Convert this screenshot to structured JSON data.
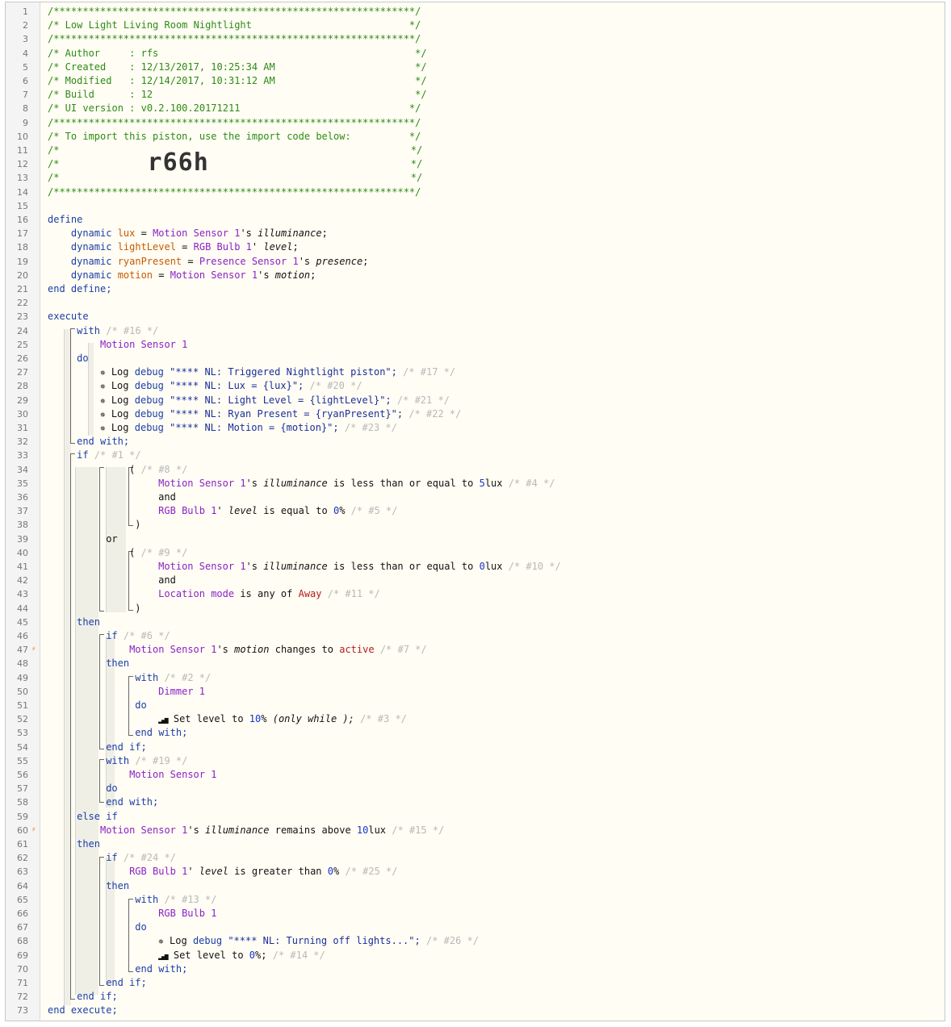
{
  "header": {
    "border": "/**************************************************************/",
    "title": "/* Low Light Living Room Nightlight                           */",
    "author": "/* Author     : rfs                                            */",
    "created": "/* Created    : 12/13/2017, 10:25:34 AM                        */",
    "modified": "/* Modified   : 12/14/2017, 10:31:12 AM                        */",
    "build": "/* Build      : 12                                             */",
    "ui_version": "/* UI version : v0.2.100.20171211                             */",
    "import_hint": "/* To import this piston, use the import code below:          */",
    "blank_open": "/*",
    "blank_close": "*/",
    "import_code": "r66h"
  },
  "define": {
    "kw_define": "define",
    "kw_end": "end define;",
    "kw_dynamic": "dynamic",
    "vars": [
      {
        "name": "lux",
        "device": "Motion Sensor 1",
        "poss": "'s",
        "attr": "illuminance"
      },
      {
        "name": "lightLevel",
        "device": "RGB Bulb 1",
        "poss": "'",
        "attr": "level"
      },
      {
        "name": "ryanPresent",
        "device": "Presence Sensor 1",
        "poss": "'s",
        "attr": "presence"
      },
      {
        "name": "motion",
        "device": "Motion Sensor 1",
        "poss": "'s",
        "attr": "motion"
      }
    ]
  },
  "execute": {
    "kw_execute": "execute",
    "kw_end_execute": "end execute;",
    "kw_with": "with",
    "kw_do": "do",
    "kw_end_with": "end with;",
    "kw_if": "if",
    "kw_then": "then",
    "kw_or": "or",
    "kw_and": "and",
    "kw_else_if": "else if",
    "kw_end_if": "end if;",
    "with16": {
      "comment": "/* #16 */",
      "device": "Motion Sensor 1"
    },
    "logs": [
      {
        "text": "\"**** NL: Triggered Nightlight piston\";",
        "comment": "/* #17 */"
      },
      {
        "text": "\"**** NL: Lux = {lux}\";",
        "comment": "/* #20 */"
      },
      {
        "text": "\"**** NL: Light Level = {lightLevel}\";",
        "comment": "/* #21 */"
      },
      {
        "text": "\"**** NL: Ryan Present = {ryanPresent}\";",
        "comment": "/* #22 */"
      },
      {
        "text": "\"**** NL: Motion = {motion}\";",
        "comment": "/* #23 */"
      }
    ],
    "log_label": "Log",
    "log_level": "debug",
    "if1": "/* #1 */",
    "grp8": "/* #8 */",
    "grp9": "/* #9 */",
    "cond4": {
      "device": "Motion Sensor 1",
      "poss": "'s",
      "attr": "illuminance",
      "op": "is less than or equal to",
      "num": "5",
      "unit": "lux",
      "comment": "/* #4 */"
    },
    "cond5": {
      "device": "RGB Bulb 1",
      "poss": "'",
      "attr": "level",
      "op": "is equal to",
      "num": "0",
      "unit": "%",
      "comment": "/* #5 */"
    },
    "cond10": {
      "device": "Motion Sensor 1",
      "poss": "'s",
      "attr": "illuminance",
      "op": "is less than or equal to",
      "num": "0",
      "unit": "lux",
      "comment": "/* #10 */"
    },
    "cond11": {
      "device": "Location mode",
      "op": "is any of",
      "val": "Away",
      "comment": "/* #11 */"
    },
    "if6": "/* #6 */",
    "cond7": {
      "device": "Motion Sensor 1",
      "poss": "'s",
      "attr": "motion",
      "op": "changes to",
      "val": "active",
      "comment": "/* #7 */"
    },
    "with2": {
      "comment": "/* #2 */",
      "device": "Dimmer 1"
    },
    "set3": {
      "label": "Set level to",
      "num": "10",
      "unit": "%",
      "extra": "(only while );",
      "comment": "/* #3 */"
    },
    "with19": {
      "comment": "/* #19 */",
      "device": "Motion Sensor 1"
    },
    "cond15": {
      "device": "Motion Sensor 1",
      "poss": "'s",
      "attr": "illuminance",
      "op": "remains above",
      "num": "10",
      "unit": "lux",
      "comment": "/* #15 */"
    },
    "if24": "/* #24 */",
    "cond25": {
      "device": "RGB Bulb 1",
      "poss": "'",
      "attr": "level",
      "op": "is greater than",
      "num": "0",
      "unit": "%",
      "comment": "/* #25 */"
    },
    "with13": {
      "comment": "/* #13 */",
      "device": "RGB Bulb 1"
    },
    "log26": {
      "text": "\"**** NL: Turning off lights...\";",
      "comment": "/* #26 */"
    },
    "set14": {
      "label": "Set level to",
      "num": "0",
      "unit": "%;",
      "comment": "/* #14 */"
    }
  },
  "line_numbers": [
    "1",
    "2",
    "3",
    "4",
    "5",
    "6",
    "7",
    "8",
    "9",
    "10",
    "11",
    "12",
    "13",
    "14",
    "15",
    "16",
    "17",
    "18",
    "19",
    "20",
    "21",
    "22",
    "23",
    "24",
    "25",
    "26",
    "27",
    "28",
    "29",
    "30",
    "31",
    "32",
    "33",
    "34",
    "35",
    "36",
    "37",
    "38",
    "39",
    "40",
    "41",
    "42",
    "43",
    "44",
    "45",
    "46",
    "47",
    "48",
    "49",
    "50",
    "51",
    "52",
    "53",
    "54",
    "55",
    "56",
    "57",
    "58",
    "59",
    "60",
    "61",
    "62",
    "63",
    "64",
    "65",
    "66",
    "67",
    "68",
    "69",
    "70",
    "71",
    "72",
    "73"
  ],
  "trigger_icon": "lightning-bolt-icon",
  "colors": {
    "keyword": "#1b3ea7",
    "device": "#8a22c7",
    "variable": "#c75a00",
    "header": "#2e8b15",
    "comment": "#b8b8b8",
    "value": "#b41c1c",
    "trigger": "#f07820"
  }
}
